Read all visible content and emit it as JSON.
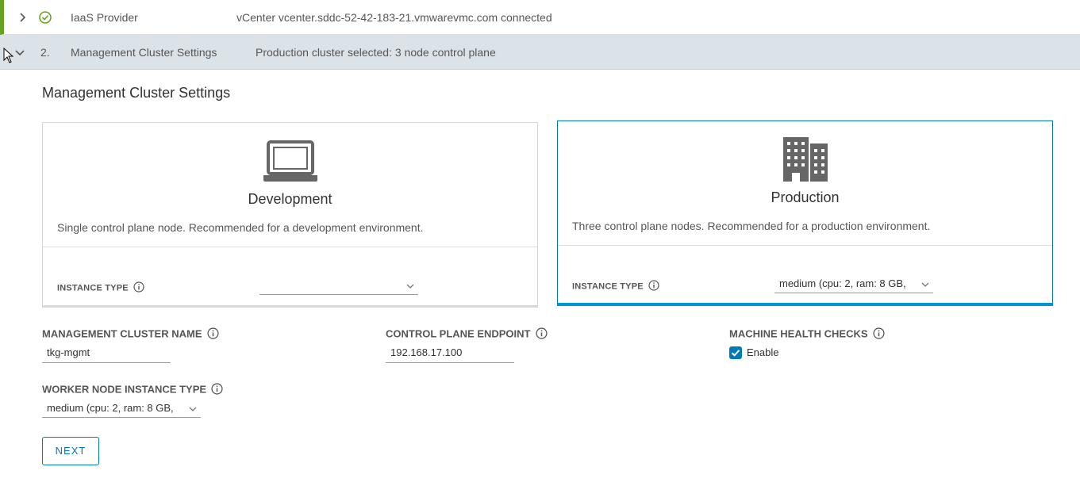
{
  "steps": [
    {
      "number": "",
      "label": "IaaS Provider",
      "summary": "vCenter vcenter.sddc-52-42-183-21.vmwarevmc.com connected",
      "status": "complete"
    },
    {
      "number": "2.",
      "label": "Management Cluster Settings",
      "summary": "Production cluster selected: 3 node control plane",
      "status": "active"
    }
  ],
  "section_title": "Management Cluster Settings",
  "cards": {
    "development": {
      "title": "Development",
      "description": "Single control plane node. Recommended for a development environment.",
      "instance_label": "INSTANCE TYPE",
      "instance_value": "",
      "icon": "laptop-icon"
    },
    "production": {
      "title": "Production",
      "description": "Three control plane nodes. Recommended for a production environment.",
      "instance_label": "INSTANCE TYPE",
      "instance_value": "medium (cpu: 2, ram: 8 GB,",
      "icon": "building-icon",
      "selected": true
    }
  },
  "form": {
    "cluster_name_label": "MANAGEMENT CLUSTER NAME",
    "cluster_name_value": "tkg-mgmt",
    "endpoint_label": "CONTROL PLANE ENDPOINT",
    "endpoint_value": "192.168.17.100",
    "health_label": "MACHINE HEALTH CHECKS",
    "health_checkbox_label": "Enable",
    "health_checked": true,
    "worker_label": "WORKER NODE INSTANCE TYPE",
    "worker_value": "medium (cpu: 2, ram: 8 GB,"
  },
  "next_label": "NEXT",
  "colors": {
    "accent": "#0079b8",
    "success": "#62a420",
    "active_row": "#dbe3e8"
  }
}
